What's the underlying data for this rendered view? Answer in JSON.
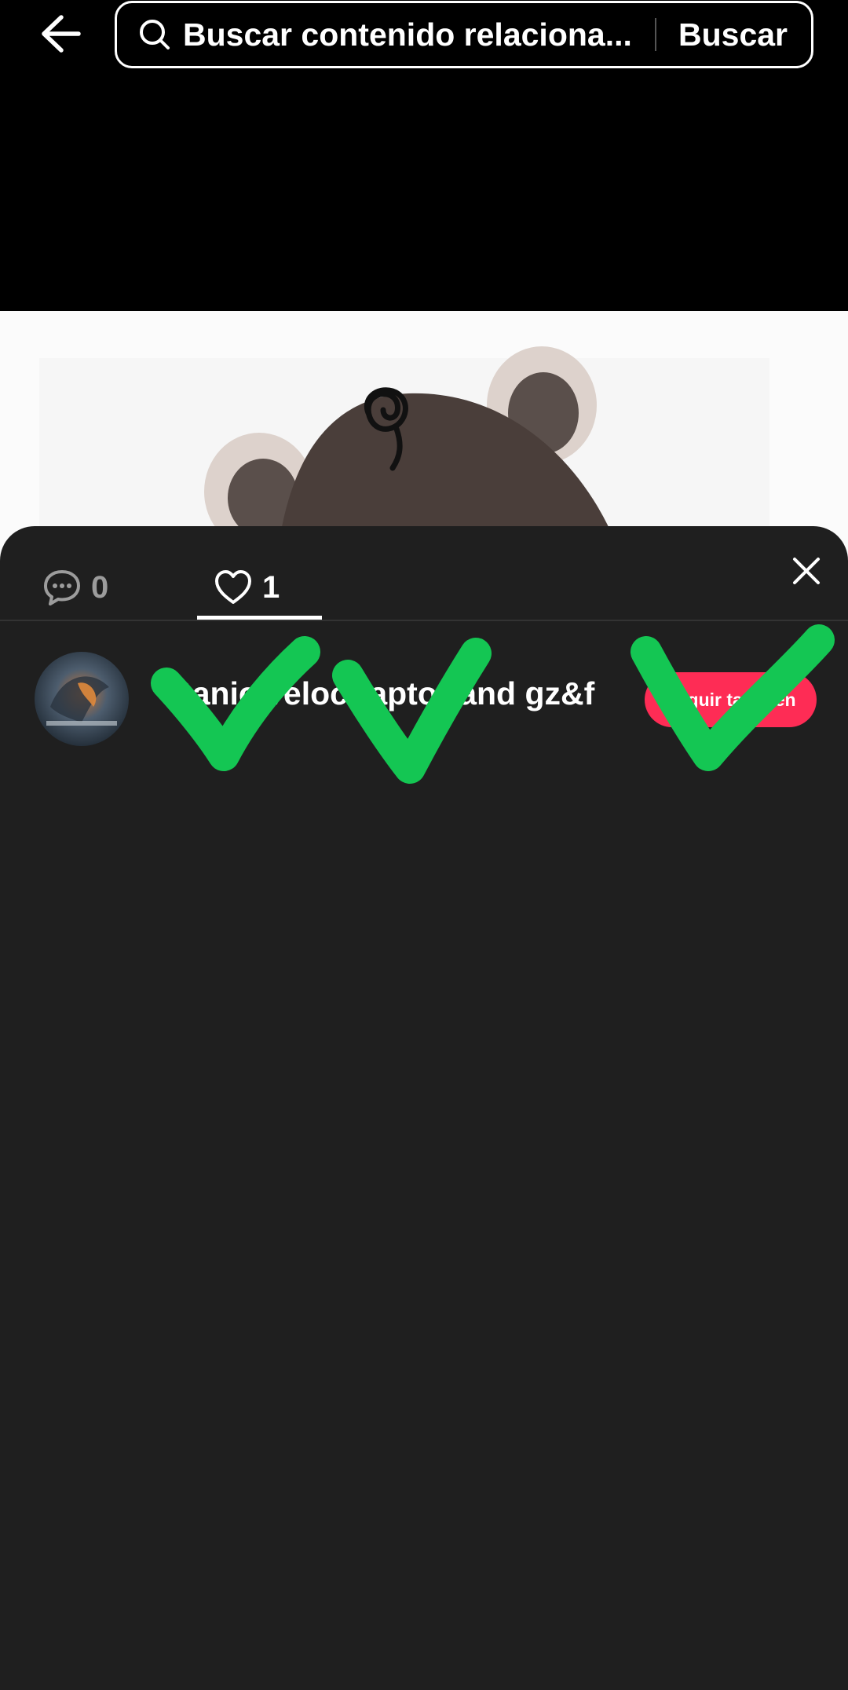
{
  "search": {
    "query": "Buscar contenido relaciona...",
    "button_label": "Buscar"
  },
  "sheet": {
    "tabs": [
      {
        "icon": "comment-icon",
        "count": "0"
      },
      {
        "icon": "heart-icon",
        "count": "1",
        "selected": true
      }
    ],
    "likers": [
      {
        "username": "titanic velociraptor and gz&f",
        "follow_label": "Seguir también"
      }
    ]
  },
  "colors": {
    "sheet_bg": "#1f1f1f",
    "accent": "#fe2c55",
    "checkmark": "#14c653"
  }
}
